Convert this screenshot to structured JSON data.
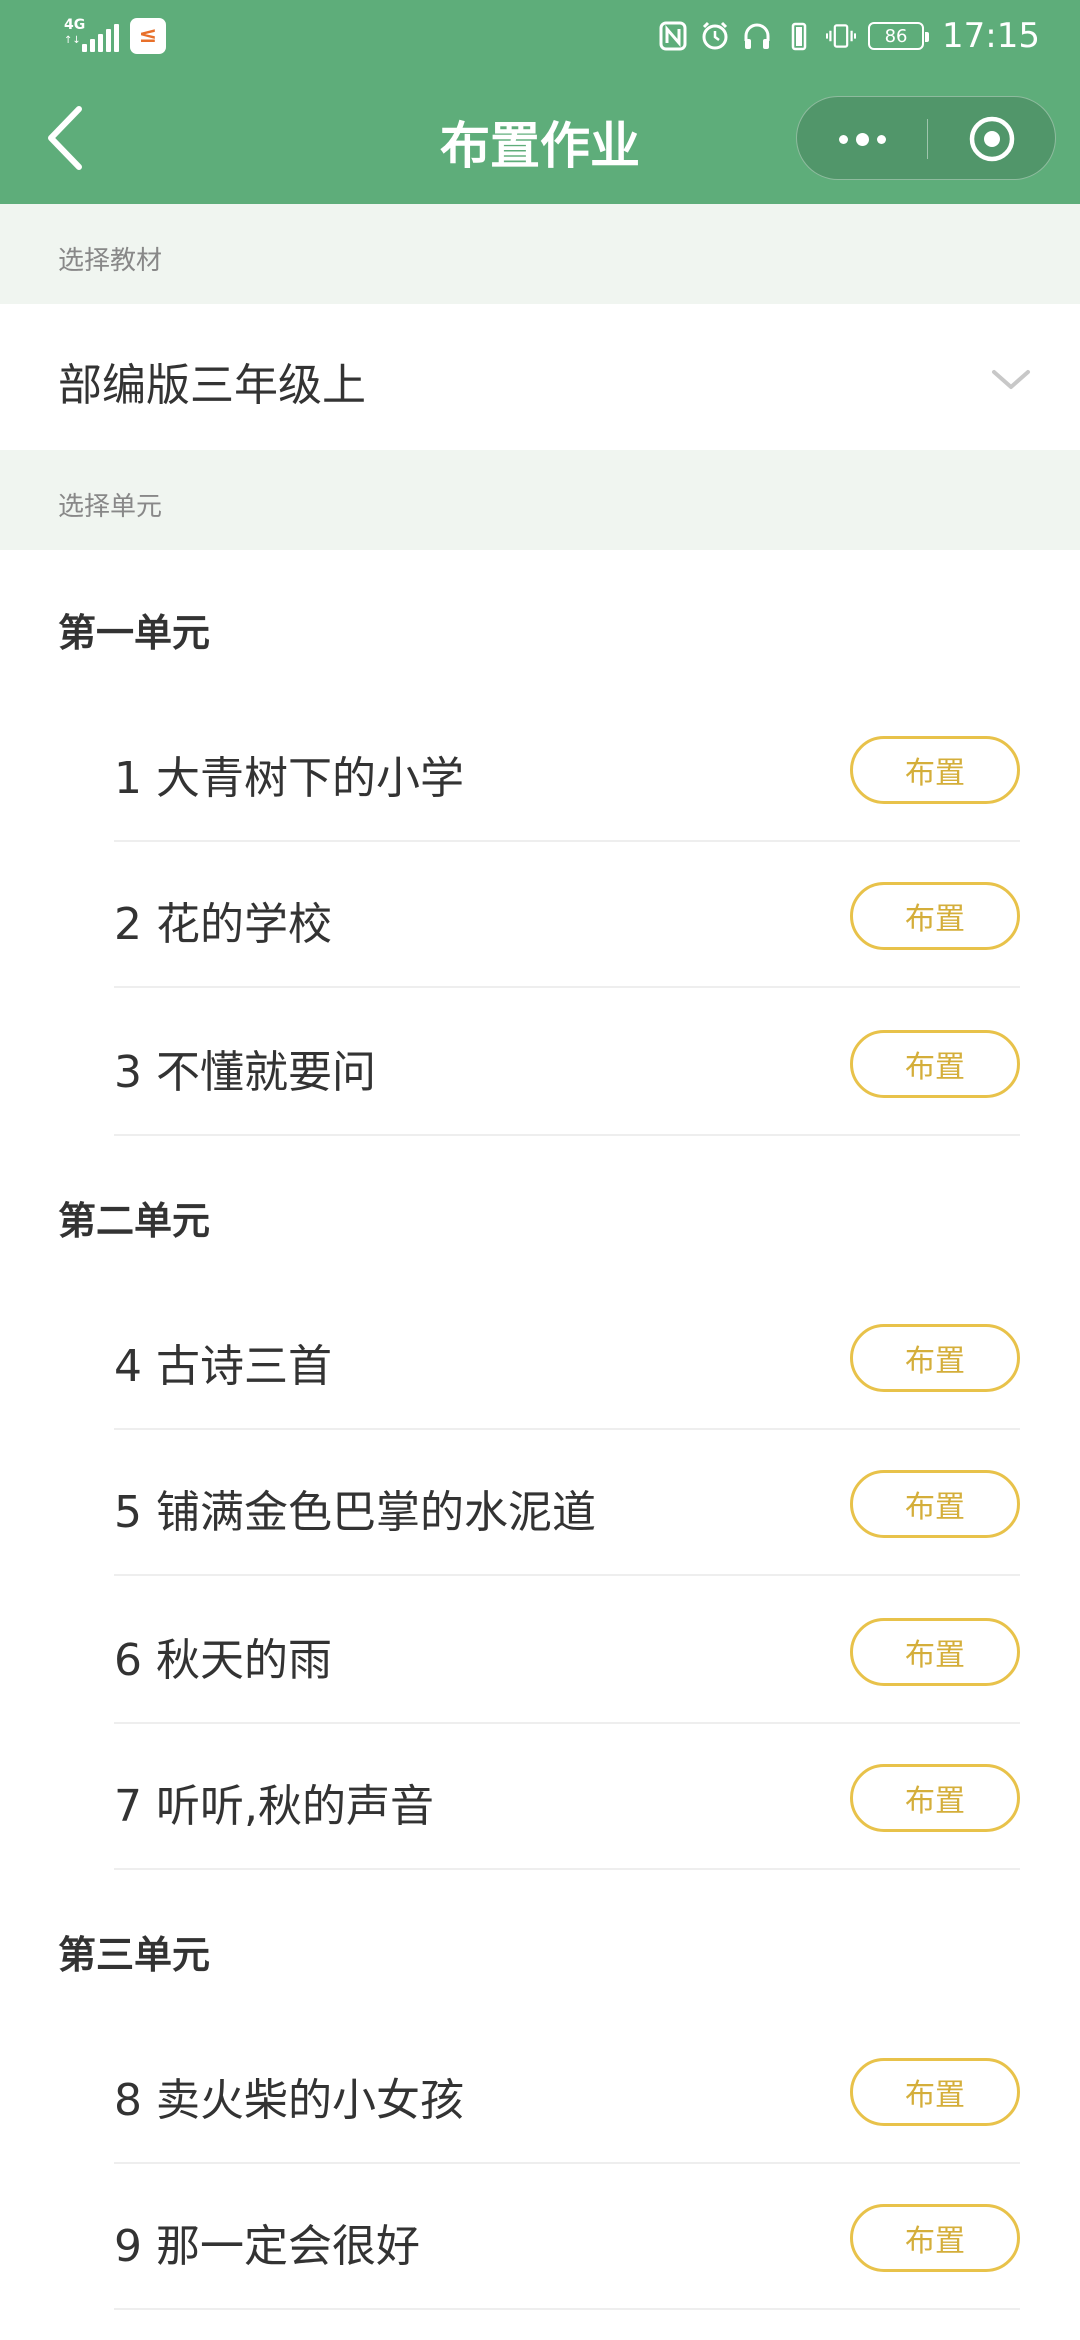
{
  "status_bar": {
    "network_label": "4G",
    "network_sub": "↑↓",
    "app_badge": "≤",
    "battery_level": "86",
    "time": "17:15"
  },
  "title_bar": {
    "title": "布置作业"
  },
  "textbook_section": {
    "header": "选择教材",
    "selected": "部编版三年级上"
  },
  "unit_section": {
    "header": "选择单元"
  },
  "units": [
    {
      "title": "第一单元",
      "lessons": [
        {
          "label": "1 大青树下的小学",
          "button": "布置"
        },
        {
          "label": "2 花的学校",
          "button": "布置"
        },
        {
          "label": "3 不懂就要问",
          "button": "布置"
        }
      ]
    },
    {
      "title": "第二单元",
      "lessons": [
        {
          "label": "4 古诗三首",
          "button": "布置"
        },
        {
          "label": "5 铺满金色巴掌的水泥道",
          "button": "布置"
        },
        {
          "label": "6 秋天的雨",
          "button": "布置"
        },
        {
          "label": "7 听听,秋的声音",
          "button": "布置"
        }
      ]
    },
    {
      "title": "第三单元",
      "lessons": [
        {
          "label": "8 卖火柴的小女孩",
          "button": "布置"
        },
        {
          "label": "9 那一定会很好",
          "button": "布置"
        }
      ]
    }
  ],
  "colors": {
    "header_green": "#5ead7a",
    "section_bg": "#f0f5f0",
    "button_border": "#e8c24a",
    "button_text": "#d4ae3a"
  },
  "icons": [
    "back-arrow-icon",
    "more-dots-icon",
    "close-target-icon",
    "chevron-down-icon",
    "nfc-icon",
    "alarm-icon",
    "headphones-icon",
    "battery-icon",
    "vibrate-icon",
    "signal-icon"
  ]
}
